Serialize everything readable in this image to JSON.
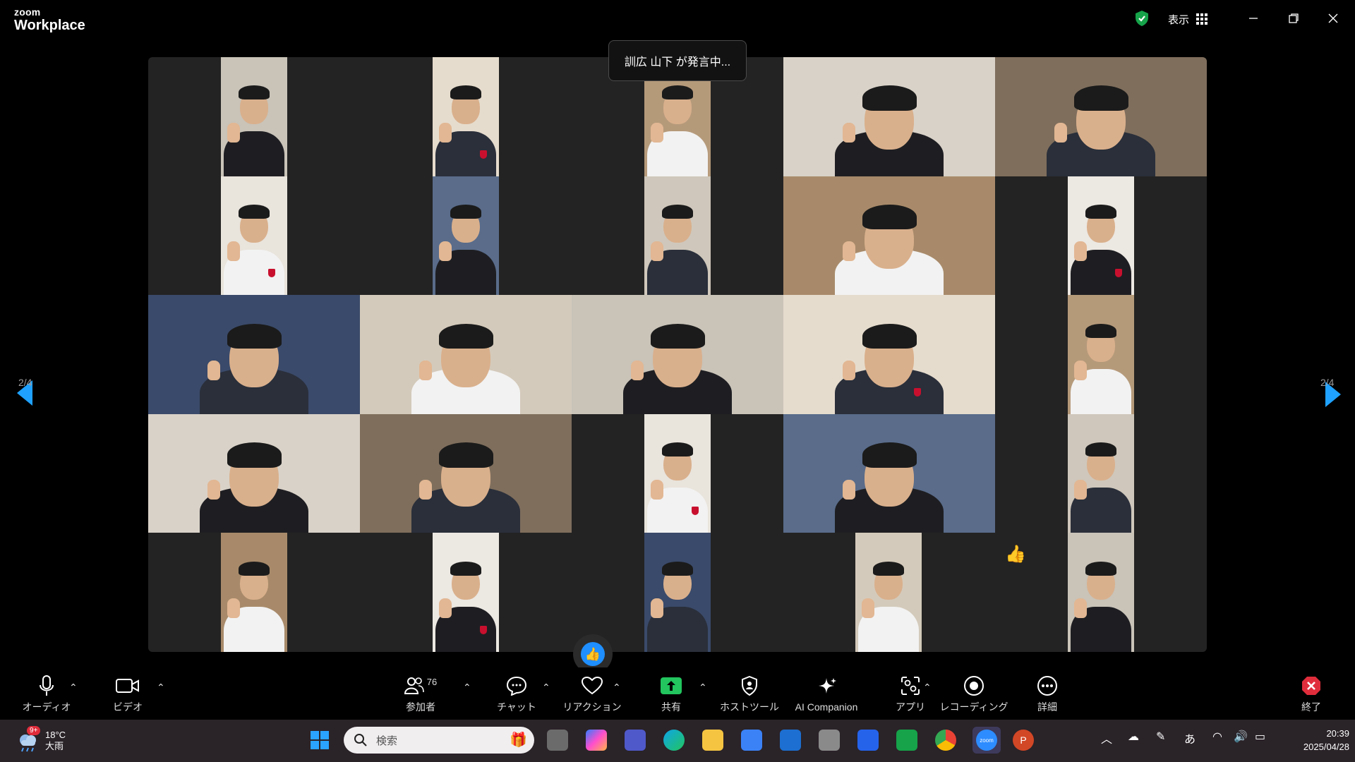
{
  "app": {
    "brand_small": "zoom",
    "brand_big": "Workplace"
  },
  "titlebar": {
    "view_label": "表示"
  },
  "speaking": "訓広 山下 が発言中...",
  "pagination": {
    "left": "2/4",
    "right": "2/4"
  },
  "toolbar": {
    "audio": "オーディオ",
    "video": "ビデオ",
    "participants": "参加者",
    "participants_count": "76",
    "chat": "チャット",
    "reactions": "リアクション",
    "share": "共有",
    "host_tools": "ホストツール",
    "ai_companion": "AI Companion",
    "apps": "アプリ",
    "recording": "レコーディング",
    "more": "詳細",
    "end": "終了"
  },
  "taskbar": {
    "weather_temp": "18°C",
    "weather_desc": "大雨",
    "weather_badge": "9+",
    "search_placeholder": "検索",
    "ime": "あ",
    "time": "20:39",
    "date": "2025/04/28"
  },
  "colors": {
    "accent": "#1fa2ff",
    "share_green": "#22c55e",
    "end_red": "#e02d3c",
    "shield_green": "#16a34a"
  }
}
